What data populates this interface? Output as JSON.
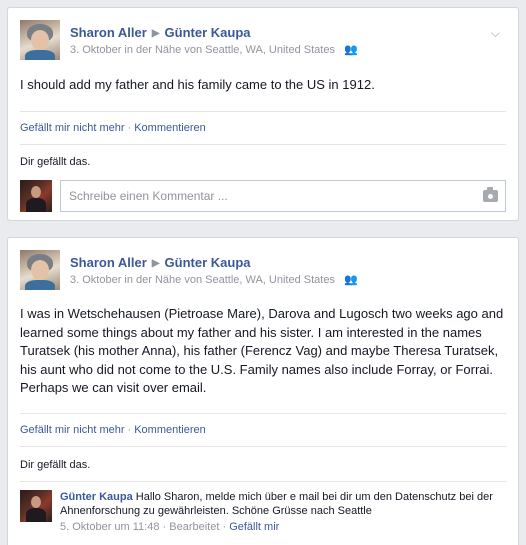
{
  "posts": [
    {
      "author": "Sharon Aller",
      "target": "Günter Kaupa",
      "meta": "3. Oktober in der Nähe von Seattle, WA, United States",
      "text": "I should add my father and his family came to the US in 1912.",
      "actions": {
        "unlike": "Gefällt mir nicht mehr",
        "comment": "Kommentieren"
      },
      "likes": "Dir gefällt das.",
      "comment_placeholder": "Schreibe einen Kommentar ..."
    },
    {
      "author": "Sharon Aller",
      "target": "Günter Kaupa",
      "meta": "3. Oktober in der Nähe von Seattle, WA, United States",
      "text": "I was in Wetschehausen (Pietroase Mare), Darova and Lugosch two weeks ago and learned some things about my father and his sister. I am interested in the names Turatsek (his mother Anna), his father (Ferencz Vag) and maybe Theresa Turatsek, his aunt who did not come to the U.S. Family names also include Forray, or Forrai. Perhaps we can visit over email.",
      "actions": {
        "unlike": "Gefällt mir nicht mehr",
        "comment": "Kommentieren"
      },
      "likes": "Dir gefällt das.",
      "reply": {
        "author": "Günter Kaupa",
        "text": "Hallo Sharon, melde mich über e mail bei dir um den Datenschutz bei der Ahnenforschung zu gewährleisten. Schöne Grüsse nach Seattle",
        "time": "5. Oktober um 11:48",
        "edited": "Bearbeitet",
        "like": "Gefällt mir"
      }
    }
  ]
}
